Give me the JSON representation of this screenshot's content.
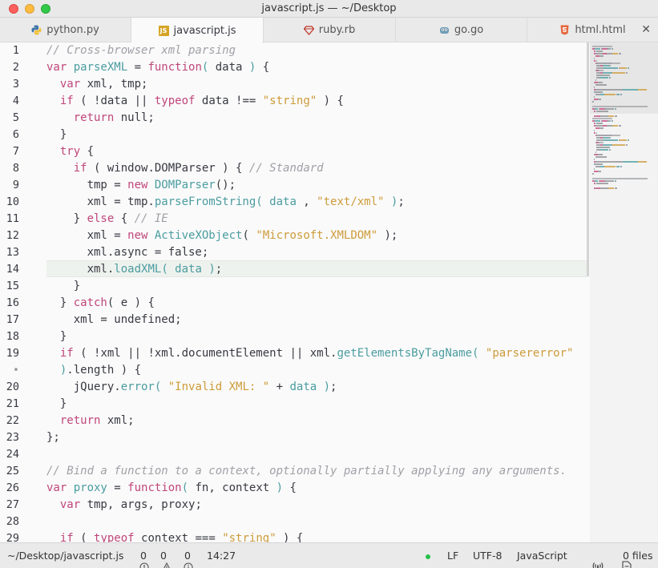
{
  "window": {
    "title": "javascript.js — ~/Desktop"
  },
  "tabs": [
    {
      "label": "python.py",
      "icon": "python-icon",
      "active": false
    },
    {
      "label": "javascript.js",
      "icon": "javascript-file-icon",
      "active": true
    },
    {
      "label": "ruby.rb",
      "icon": "ruby-gem-icon",
      "active": false
    },
    {
      "label": "go.go",
      "icon": "gopher-icon",
      "active": false
    },
    {
      "label": "html.html",
      "icon": "html5-icon",
      "active": false
    }
  ],
  "tab_close_glyph": "✕",
  "gutter": [
    "1",
    "2",
    "3",
    "4",
    "5",
    "6",
    "7",
    "8",
    "9",
    "10",
    "11",
    "12",
    "13",
    "14",
    "15",
    "16",
    "17",
    "18",
    "19",
    "•",
    "20",
    "21",
    "22",
    "23",
    "24",
    "25",
    "26",
    "27",
    "28",
    "29"
  ],
  "code_lines": [
    [
      [
        "c",
        "// Cross-browser xml parsing"
      ]
    ],
    [
      [
        "k",
        "var "
      ],
      [
        "f",
        "parseXML"
      ],
      [
        "v",
        " = "
      ],
      [
        "k",
        "function"
      ],
      [
        "p",
        "( "
      ],
      [
        "v",
        "data"
      ],
      [
        "p",
        " ) "
      ],
      [
        "v",
        "{"
      ]
    ],
    [
      [
        "k",
        "  var "
      ],
      [
        "v",
        "xml, tmp;"
      ]
    ],
    [
      [
        "k",
        "  if "
      ],
      [
        "v",
        "( !data || "
      ],
      [
        "k",
        "typeof "
      ],
      [
        "v",
        "data !== "
      ],
      [
        "s",
        "\"string\""
      ],
      [
        "v",
        " ) {"
      ]
    ],
    [
      [
        "k",
        "    return "
      ],
      [
        "v",
        "null;"
      ]
    ],
    [
      [
        "v",
        "  }"
      ]
    ],
    [
      [
        "k",
        "  try "
      ],
      [
        "v",
        "{"
      ]
    ],
    [
      [
        "k",
        "    if "
      ],
      [
        "v",
        "( window.DOMParser ) { "
      ],
      [
        "c",
        "// Standard"
      ]
    ],
    [
      [
        "v",
        "      tmp = "
      ],
      [
        "k",
        "new "
      ],
      [
        "f",
        "DOMParser"
      ],
      [
        "v",
        "();"
      ]
    ],
    [
      [
        "v",
        "      xml = tmp."
      ],
      [
        "f",
        "parseFromString"
      ],
      [
        "p",
        "( "
      ],
      [
        "f",
        "data"
      ],
      [
        "v",
        " , "
      ],
      [
        "s",
        "\"text/xml\""
      ],
      [
        "p",
        " )"
      ],
      [
        "v",
        ";"
      ]
    ],
    [
      [
        "v",
        "    } "
      ],
      [
        "k",
        "else "
      ],
      [
        "v",
        "{ "
      ],
      [
        "c",
        "// IE"
      ]
    ],
    [
      [
        "v",
        "      xml = "
      ],
      [
        "k",
        "new "
      ],
      [
        "f",
        "ActiveXObject"
      ],
      [
        "v",
        "( "
      ],
      [
        "s",
        "\"Microsoft.XMLDOM\""
      ],
      [
        "v",
        " );"
      ]
    ],
    [
      [
        "v",
        "      xml.async = false;"
      ]
    ],
    [
      [
        "v",
        "      xml."
      ],
      [
        "f",
        "loadXML"
      ],
      [
        "p",
        "( "
      ],
      [
        "f",
        "data"
      ],
      [
        "p",
        " )"
      ],
      [
        "v",
        ";"
      ]
    ],
    [
      [
        "v",
        "    }"
      ]
    ],
    [
      [
        "v",
        "  } "
      ],
      [
        "k",
        "catch"
      ],
      [
        "v",
        "( e ) {"
      ]
    ],
    [
      [
        "v",
        "    xml = undefined;"
      ]
    ],
    [
      [
        "v",
        "  }"
      ]
    ],
    [
      [
        "k",
        "  if "
      ],
      [
        "v",
        "( !xml || !xml.documentElement || xml."
      ],
      [
        "f",
        "getElementsByTagName"
      ],
      [
        "p",
        "( "
      ],
      [
        "s",
        "\"parsererror\""
      ]
    ],
    [
      [
        "p",
        "  )"
      ],
      [
        "v",
        ".length ) {"
      ]
    ],
    [
      [
        "v",
        "    jQuery."
      ],
      [
        "f",
        "error"
      ],
      [
        "p",
        "( "
      ],
      [
        "s",
        "\"Invalid XML: \""
      ],
      [
        "v",
        " + "
      ],
      [
        "f",
        "data"
      ],
      [
        "p",
        " )"
      ],
      [
        "v",
        ";"
      ]
    ],
    [
      [
        "v",
        "  }"
      ]
    ],
    [
      [
        "k",
        "  return "
      ],
      [
        "v",
        "xml;"
      ]
    ],
    [
      [
        "v",
        "};"
      ]
    ],
    [
      [
        "v",
        ""
      ]
    ],
    [
      [
        "c",
        "// Bind a function to a context, optionally partially applying any arguments."
      ]
    ],
    [
      [
        "k",
        "var "
      ],
      [
        "f",
        "proxy"
      ],
      [
        "v",
        " = "
      ],
      [
        "k",
        "function"
      ],
      [
        "p",
        "( "
      ],
      [
        "v",
        "fn, context"
      ],
      [
        "p",
        " ) "
      ],
      [
        "v",
        "{"
      ]
    ],
    [
      [
        "k",
        "  var "
      ],
      [
        "v",
        "tmp, args, proxy;"
      ]
    ],
    [
      [
        "v",
        ""
      ]
    ],
    [
      [
        "k",
        "  if "
      ],
      [
        "v",
        "( "
      ],
      [
        "k",
        "typeof "
      ],
      [
        "v",
        "context === "
      ],
      [
        "s",
        "\"string\""
      ],
      [
        "v",
        " ) {"
      ]
    ]
  ],
  "colors": {
    "keyword": "#c0467b",
    "function": "#4b9ca0",
    "string": "#cd9b3a",
    "comment": "#a0a1a7",
    "text": "#383a42"
  },
  "status": {
    "path": "~/Desktop/javascript.js",
    "errors": "0",
    "warnings": "0",
    "infos": "0",
    "cursor": "14:27",
    "line_ending": "LF",
    "encoding": "UTF-8",
    "grammar": "JavaScript",
    "files": "0 files"
  }
}
